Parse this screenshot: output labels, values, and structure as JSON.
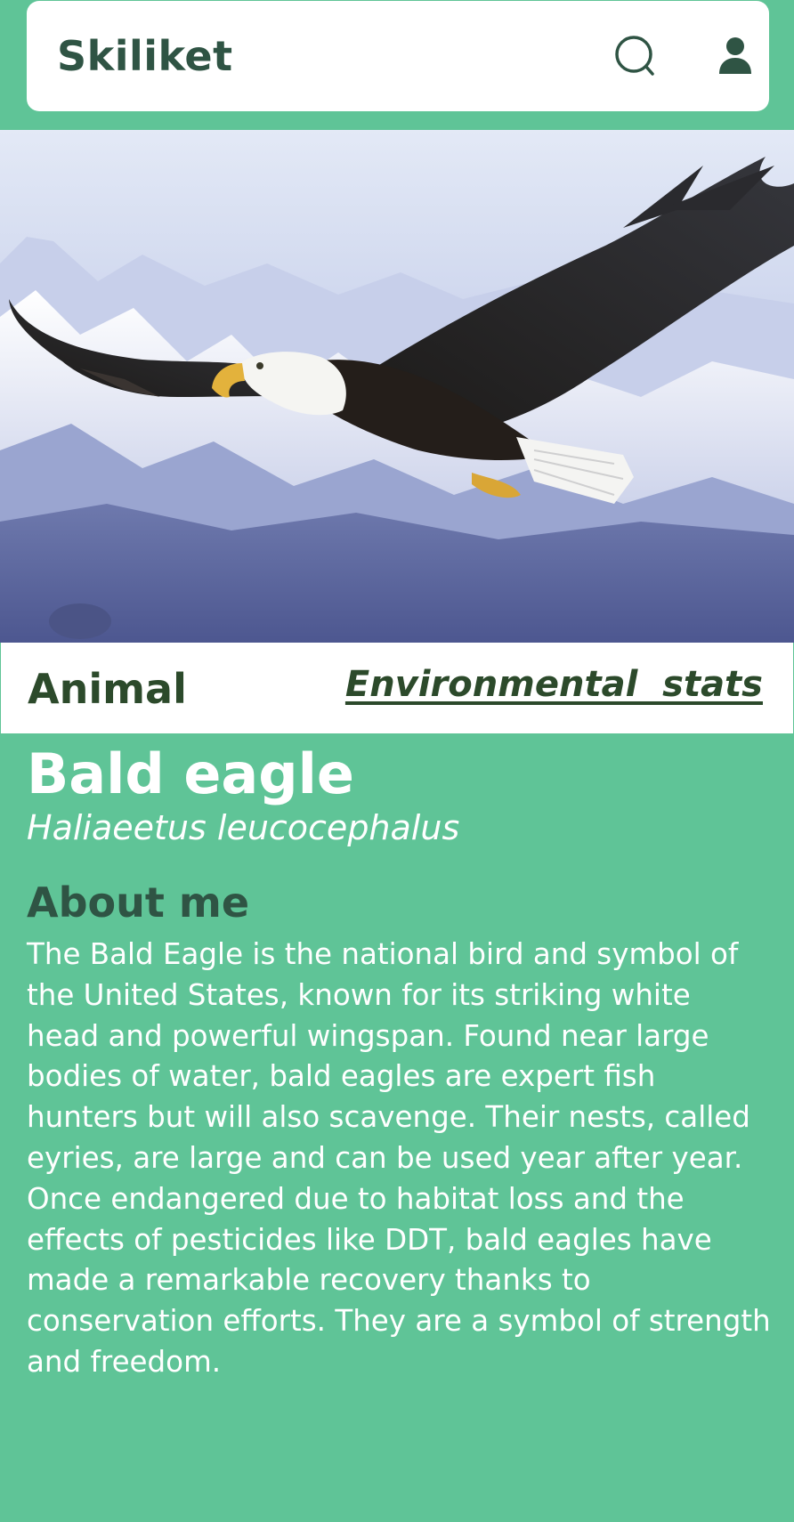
{
  "header": {
    "brand": "Skiliket",
    "search_icon": "search-icon",
    "user_icon": "user-icon"
  },
  "hero": {
    "subject": "bald-eagle-photo"
  },
  "tabs": {
    "animal_label": "Animal",
    "environmental_label": "Environmental  stats"
  },
  "animal": {
    "common_name": "Bald eagle",
    "scientific_name": "Haliaeetus leucocephalus",
    "about_heading": "About me",
    "about_text": "The Bald Eagle is the national bird and symbol of the United States, known for its striking white head and powerful wingspan. Found near large bodies of water, bald eagles are expert fish hunters but will also scavenge. Their nests, called eyries, are large and can be used year after year. Once endangered due to habitat loss and the effects of pesticides like DDT, bald eagles have made a remarkable recovery thanks to conservation efforts. They are a symbol of strength and freedom."
  },
  "colors": {
    "background": "#5fc497",
    "header_bg": "#ffffff",
    "brand_text": "#2f5444",
    "tab_text": "#2c4a2b",
    "content_text": "#ffffff"
  }
}
